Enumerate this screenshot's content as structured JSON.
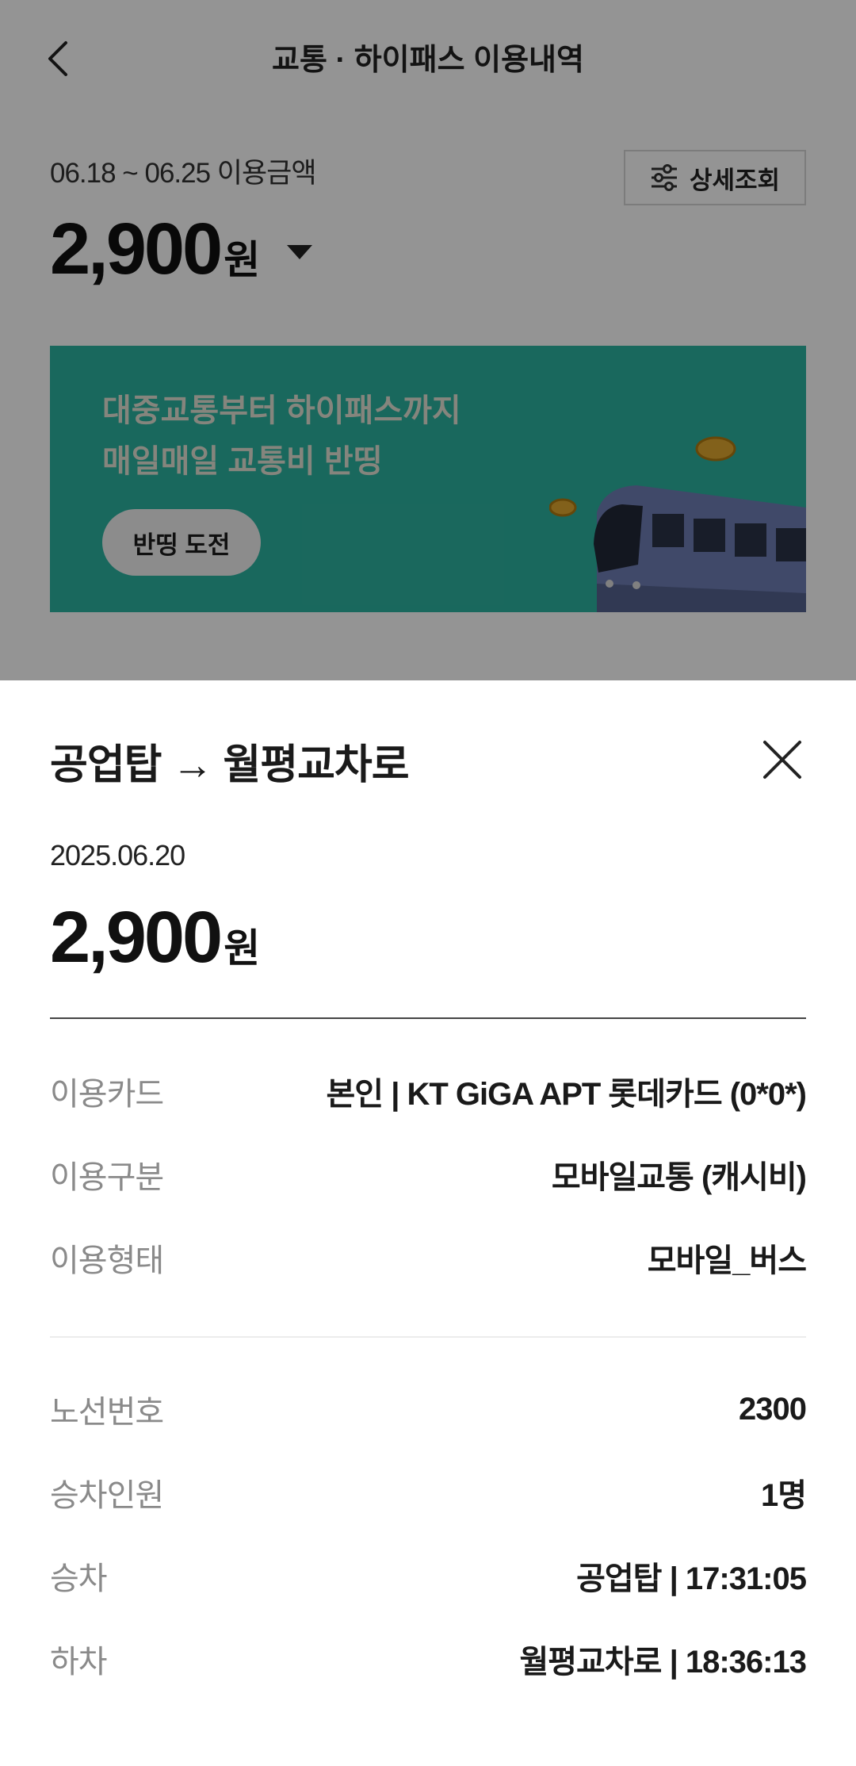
{
  "header": {
    "title": "교통 · 하이패스 이용내역"
  },
  "summary": {
    "period_label": "06.18 ~ 06.25 이용금액",
    "detail_button_label": "상세조회",
    "total_amount": "2,900",
    "currency_unit": "원"
  },
  "banner": {
    "line1": "대중교통부터 하이패스까지",
    "line2": "매일매일 교통비 반띵",
    "button_label": "반띵 도전",
    "background_color": "#2cb3a1"
  },
  "sheet": {
    "title": "공업탑 → 월평교차로",
    "date": "2025.06.20",
    "amount": "2,900",
    "currency_unit": "원",
    "details_group1": [
      {
        "label": "이용카드",
        "value": "본인 | KT GiGA APT 롯데카드 (0*0*)"
      },
      {
        "label": "이용구분",
        "value": "모바일교통 (캐시비)"
      },
      {
        "label": "이용형태",
        "value": "모바일_버스"
      }
    ],
    "details_group2": [
      {
        "label": "노선번호",
        "value": "2300"
      },
      {
        "label": "승차인원",
        "value": "1명"
      },
      {
        "label": "승차",
        "value": "공업탑 | 17:31:05"
      },
      {
        "label": "하차",
        "value": "월평교차로 | 18:36:13"
      }
    ]
  },
  "icons": {
    "back": "chevron-left-icon",
    "filter": "sliders-icon",
    "dropdown": "caret-down-icon",
    "close": "close-icon"
  }
}
